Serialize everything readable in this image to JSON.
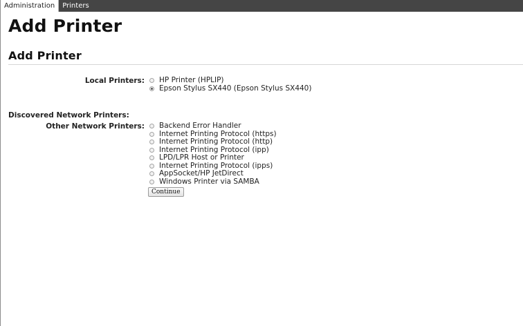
{
  "tabs": [
    {
      "label": "Administration"
    },
    {
      "label": "Printers"
    }
  ],
  "page_title": "Add Printer",
  "section_title": "Add Printer",
  "local_printers": {
    "label": "Local Printers:",
    "options": [
      {
        "label": "HP Printer (HPLIP)",
        "selected": false
      },
      {
        "label": "Epson Stylus SX440 (Epson Stylus SX440)",
        "selected": true
      }
    ]
  },
  "discovered_label": "Discovered Network Printers:",
  "other_printers": {
    "label": "Other Network Printers:",
    "options": [
      {
        "label": "Backend Error Handler",
        "selected": false
      },
      {
        "label": "Internet Printing Protocol (https)",
        "selected": false
      },
      {
        "label": "Internet Printing Protocol (http)",
        "selected": false
      },
      {
        "label": "Internet Printing Protocol (ipp)",
        "selected": false
      },
      {
        "label": "LPD/LPR Host or Printer",
        "selected": false
      },
      {
        "label": "Internet Printing Protocol (ipps)",
        "selected": false
      },
      {
        "label": "AppSocket/HP JetDirect",
        "selected": false
      },
      {
        "label": "Windows Printer via SAMBA",
        "selected": false
      }
    ]
  },
  "continue_label": "Continue"
}
